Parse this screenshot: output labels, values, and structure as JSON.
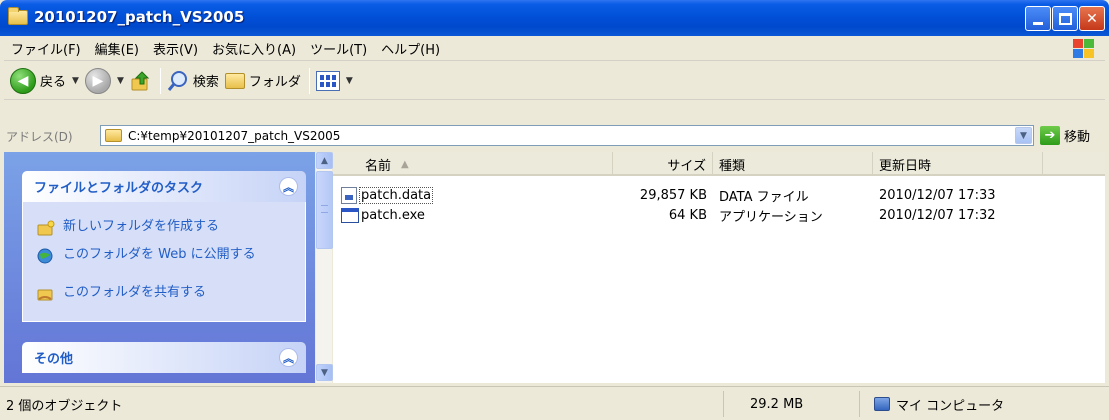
{
  "window": {
    "title": "20101207_patch_VS2005"
  },
  "menu": {
    "items": [
      "ファイル(F)",
      "編集(E)",
      "表示(V)",
      "お気に入り(A)",
      "ツール(T)",
      "ヘルプ(H)"
    ]
  },
  "toolbar": {
    "back_label": "戻る",
    "search_label": "検索",
    "folders_label": "フォルダ"
  },
  "address": {
    "label": "アドレス(D)",
    "path": "C:¥temp¥20101207_patch_VS2005",
    "go_label": "移動"
  },
  "taskpane": {
    "file_tasks_title": "ファイルとフォルダのタスク",
    "file_tasks": [
      "新しいフォルダを作成する",
      "このフォルダを Web に公開する",
      "このフォルダを共有する"
    ],
    "other_title": "その他"
  },
  "filelist": {
    "columns": {
      "name": "名前",
      "size": "サイズ",
      "type": "種類",
      "modified": "更新日時"
    },
    "rows": [
      {
        "name": "patch.data",
        "size": "29,857 KB",
        "type": "DATA ファイル",
        "modified": "2010/12/07 17:33"
      },
      {
        "name": "patch.exe",
        "size": "64 KB",
        "type": "アプリケーション",
        "modified": "2010/12/07 17:32"
      }
    ]
  },
  "statusbar": {
    "objects": "2 個のオブジェクト",
    "total_size": "29.2 MB",
    "zone": "マイ コンピュータ"
  },
  "colors": {
    "titlebar": "#0250D8",
    "taskpane": "#6F8FE0",
    "task_link": "#215DC6"
  }
}
